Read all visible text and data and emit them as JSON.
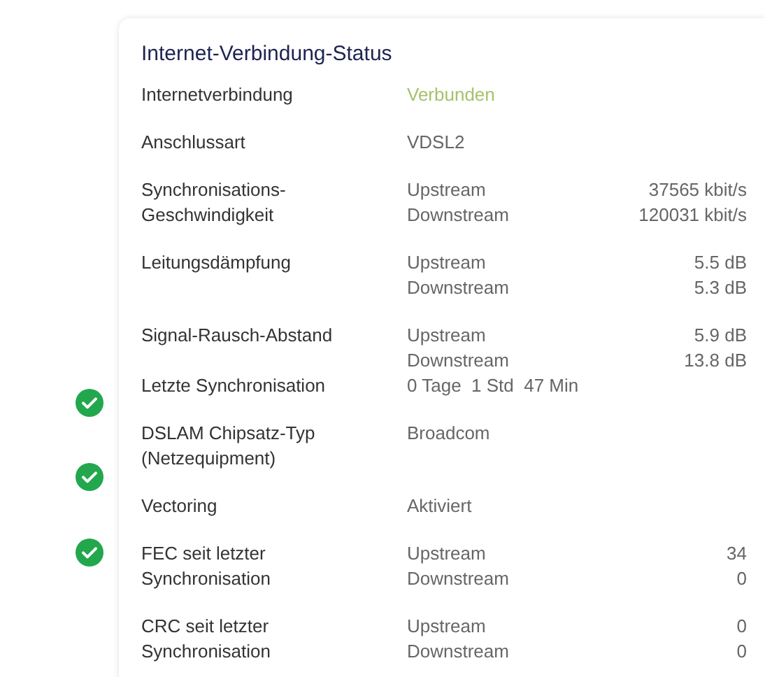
{
  "card": {
    "title": "Internet-Verbindung-Status"
  },
  "rows": [
    {
      "kind": "status",
      "label": "Internetverbindung",
      "value": "Verbunden"
    },
    {
      "kind": "text",
      "label": "Anschlussart",
      "value": "VDSL2"
    },
    {
      "kind": "pair",
      "label": "Synchronisations-Geschwindigkeit",
      "lines": [
        {
          "name": "Upstream",
          "value": "37565 kbit/s"
        },
        {
          "name": "Downstream",
          "value": "120031 kbit/s"
        }
      ]
    },
    {
      "kind": "pair",
      "label": "Leitungsdämpfung",
      "lines": [
        {
          "name": "Upstream",
          "value": "5.5 dB"
        },
        {
          "name": "Downstream",
          "value": "5.3 dB"
        }
      ]
    },
    {
      "kind": "pair",
      "label": "Signal-Rausch-Abstand",
      "lines": [
        {
          "name": "Upstream",
          "value": "5.9 dB"
        },
        {
          "name": "Downstream",
          "value": "13.8 dB"
        }
      ]
    },
    {
      "kind": "text",
      "label": "Letzte Synchronisation",
      "value": "0 Tage  1 Std  47 Min"
    },
    {
      "kind": "text",
      "label": "DSLAM Chipsatz-Typ (Netzequipment)",
      "value": "Broadcom"
    },
    {
      "kind": "text",
      "label": "Vectoring",
      "value": "Aktiviert"
    },
    {
      "kind": "pair",
      "label": "FEC seit letzter Synchronisation",
      "lines": [
        {
          "name": "Upstream",
          "value": "34"
        },
        {
          "name": "Downstream",
          "value": "0"
        }
      ]
    },
    {
      "kind": "pair",
      "label": "CRC seit letzter Synchronisation",
      "lines": [
        {
          "name": "Upstream",
          "value": "0"
        },
        {
          "name": "Downstream",
          "value": "0"
        }
      ]
    }
  ]
}
